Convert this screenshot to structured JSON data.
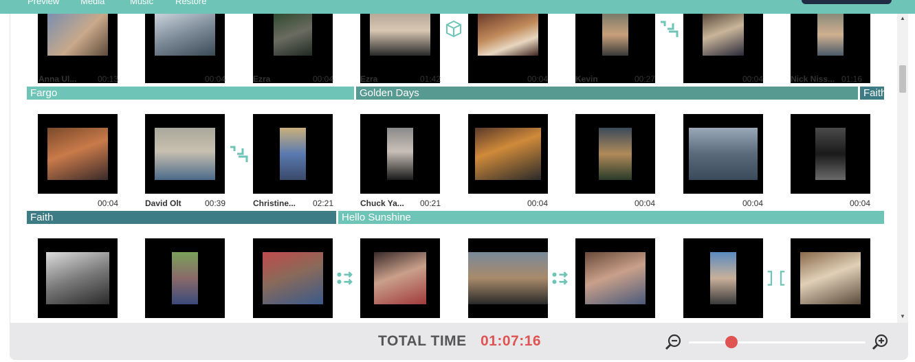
{
  "top_tabs": [
    "Preview",
    "Media",
    "Music",
    "Restore"
  ],
  "rows": [
    {
      "clips": [
        {
          "name": "Anna Ul...",
          "duration": "00:13"
        },
        {
          "name": "",
          "duration": "00:04"
        },
        {
          "name": "Ezra",
          "duration": "00:04"
        },
        {
          "name": "Ezra",
          "duration": "01:42"
        },
        {
          "name": "",
          "duration": "00:04"
        },
        {
          "name": "Kevin",
          "duration": "00:27"
        },
        {
          "name": "",
          "duration": "00:04"
        },
        {
          "name": "Nick Niss...",
          "duration": "01:16"
        }
      ],
      "songs": [
        "Fargo",
        "Golden Days",
        "Faith"
      ]
    },
    {
      "clips": [
        {
          "name": "",
          "duration": "00:04"
        },
        {
          "name": "David Olt",
          "duration": "00:39"
        },
        {
          "name": "Christine...",
          "duration": "02:21"
        },
        {
          "name": "Chuck Ya...",
          "duration": "00:21"
        },
        {
          "name": "",
          "duration": "00:04"
        },
        {
          "name": "",
          "duration": "00:04"
        },
        {
          "name": "",
          "duration": "00:04"
        },
        {
          "name": "",
          "duration": "00:04"
        }
      ],
      "songs": [
        "Faith",
        "Hello Sunshine"
      ]
    },
    {
      "clips": [
        {
          "name": "",
          "duration": ""
        },
        {
          "name": "",
          "duration": ""
        },
        {
          "name": "",
          "duration": ""
        },
        {
          "name": "",
          "duration": ""
        },
        {
          "name": "",
          "duration": ""
        },
        {
          "name": "",
          "duration": ""
        },
        {
          "name": "",
          "duration": ""
        },
        {
          "name": "",
          "duration": ""
        }
      ],
      "songs": []
    }
  ],
  "footer": {
    "total_label": "TOTAL TIME",
    "total_value": "01:07:16",
    "zoom_level": 0.24
  },
  "colors": {
    "accent": "#6ec4b6",
    "band_light": "#6ec4b6",
    "band_mid": "#579a91",
    "band_dark": "#3d7b85",
    "total_red": "#e05353"
  },
  "icons": [
    "cube-icon",
    "corner-transition-icon",
    "slide-transition-icon",
    "split-transition-icon",
    "zoom-out-icon",
    "zoom-in-icon"
  ]
}
